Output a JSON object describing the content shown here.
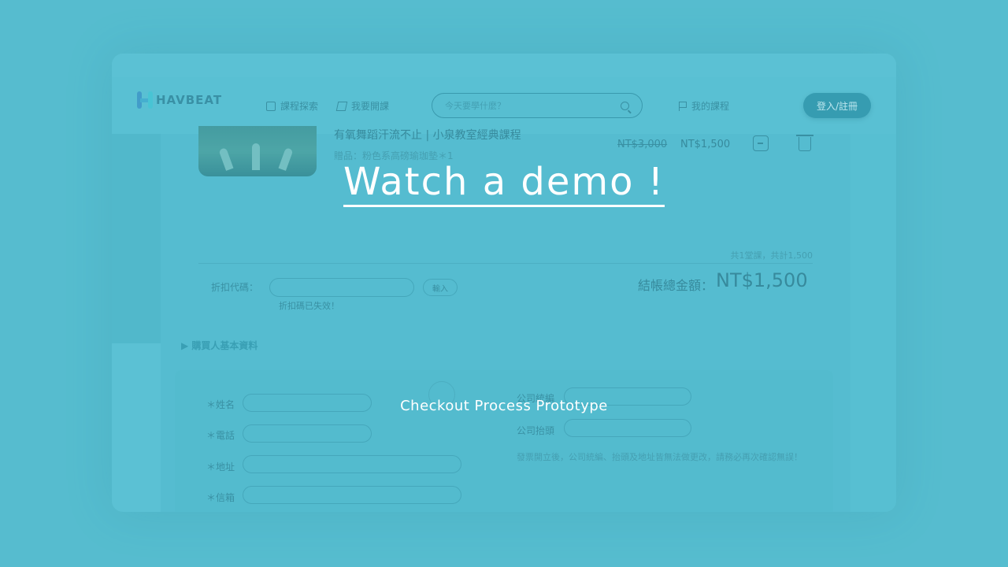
{
  "header": {
    "logo_text": "HAVBEAT",
    "nav": [
      "課程探索",
      "我要開課"
    ],
    "search_placeholder": "今天要學什麼？",
    "my_courses": "我的課程",
    "login": "登入/註冊"
  },
  "cart": {
    "course_title": "有氧舞蹈汗流不止 | 小泉教室經典課程",
    "gift": "贈品：粉色系高磅瑜珈墊＊1",
    "price_original": "NT$3,000",
    "price_sale": "NT$1,500",
    "summary": "共1堂課，共計1,500"
  },
  "discount": {
    "label": "折扣代碼：",
    "apply": "輸入",
    "error": "折扣碼已失效！"
  },
  "total": {
    "label": "結帳總金額：",
    "value": "NT$1,500"
  },
  "buyer_section": {
    "title": "▶ 購買人基本資料",
    "fields": [
      "＊姓名",
      "＊電話",
      "＊地址",
      "＊信箱"
    ],
    "company_fields": [
      "公司統編",
      "公司抬頭"
    ],
    "note": "發票開立後，公司統編、抬頭及地址皆無法做更改，請務必再次確認無誤！"
  },
  "overlay": {
    "cta": "Watch a demo !",
    "caption": "Checkout Process Prototype"
  }
}
